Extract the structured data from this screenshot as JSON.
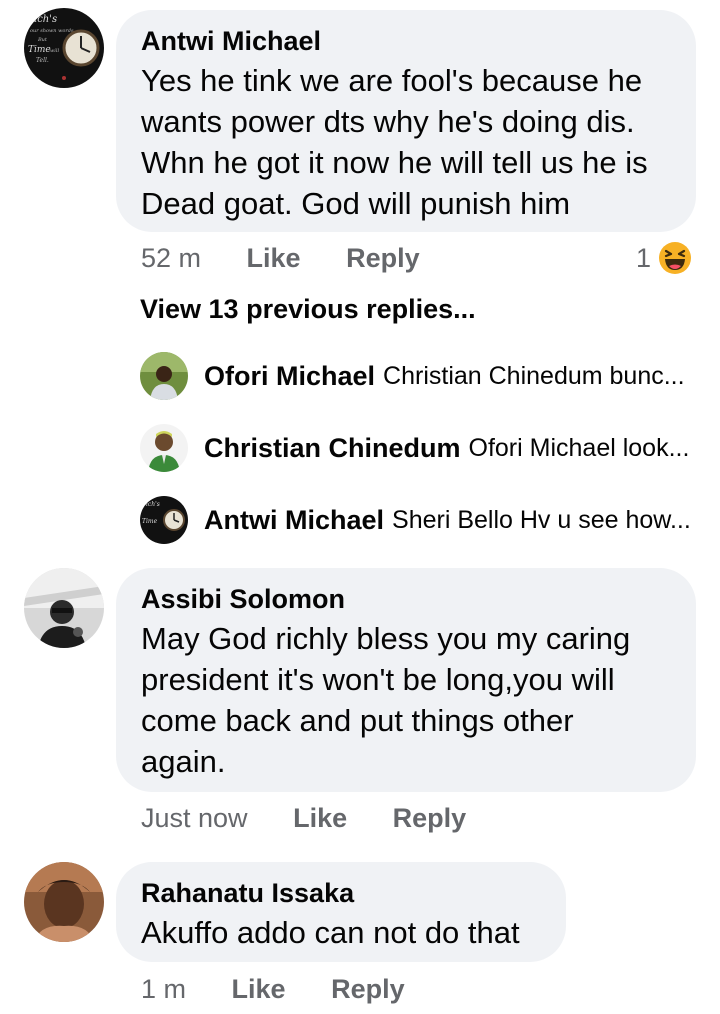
{
  "comments": [
    {
      "author": "Antwi Michael",
      "lines": [
        "Yes he tink we are fool's because he",
        "wants power dts why he's doing dis.",
        "Whn he got it now he will tell us he is",
        "Dead goat. God will punish him"
      ],
      "time": "52 m",
      "like_label": "Like",
      "reply_label": "Reply",
      "reaction_count": "1",
      "reaction_icon": "haha-emoji-icon"
    },
    {
      "author": "Assibi Solomon",
      "lines": [
        "May God richly bless you my caring",
        "president it's won't be long,you will",
        "come back and put things other",
        "again."
      ],
      "time": "Just now",
      "like_label": "Like",
      "reply_label": "Reply"
    },
    {
      "author": "Rahanatu Issaka",
      "lines": [
        "Akuffo addo can not do that"
      ],
      "time": "1 m",
      "like_label": "Like",
      "reply_label": "Reply"
    }
  ],
  "avatar_text": {
    "line1": "ich's",
    "line2": "our shown words",
    "line3": "But",
    "line4": "Time",
    "line5": "will",
    "line6": "Tell."
  },
  "view_previous_replies": "View 13 previous replies...",
  "replies": [
    {
      "author": "Ofori Michael",
      "preview": "Christian Chinedum bunc..."
    },
    {
      "author": "Christian Chinedum",
      "preview": "Ofori Michael look..."
    },
    {
      "author": "Antwi Michael",
      "preview": "Sheri Bello Hv u see how..."
    }
  ],
  "colors": {
    "bubble": "#f0f2f5",
    "meta": "#65676b",
    "text": "#050505",
    "reaction": "#f7b125"
  }
}
